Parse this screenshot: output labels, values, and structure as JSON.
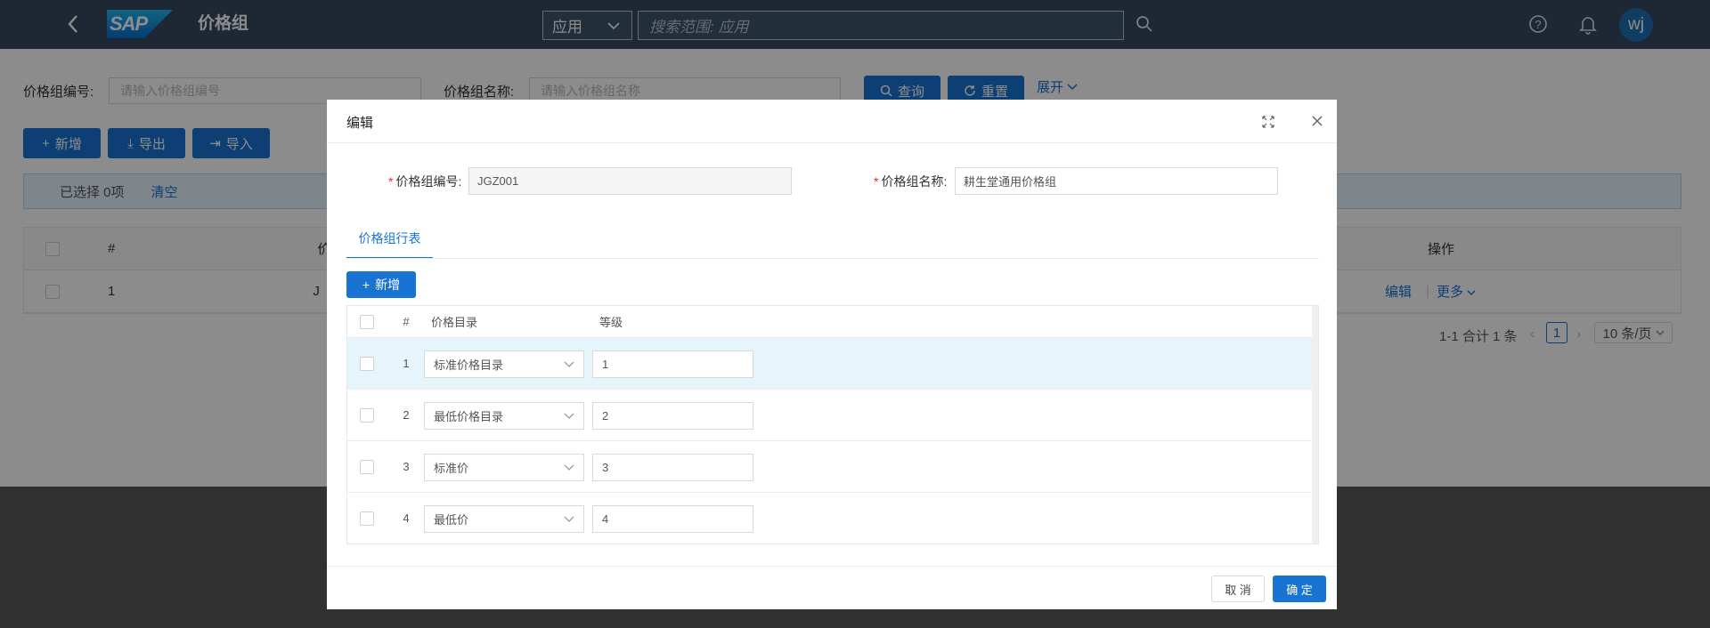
{
  "shell": {
    "app_title": "价格组",
    "logo_text": "SAP",
    "scope_value": "应用",
    "search_placeholder": "搜索范围: 应用",
    "avatar_initials": "wj"
  },
  "filters": {
    "code_label": "价格组编号:",
    "code_placeholder": "请输入价格组编号",
    "name_label": "价格组名称:",
    "name_placeholder": "请输入价格组名称",
    "query_label": "查询",
    "reset_label": "重置",
    "expand_label": "展开"
  },
  "toolbar": {
    "add_label": "新增",
    "export_label": "导出",
    "import_label": "导入"
  },
  "selection": {
    "summary": "已选择 0项",
    "clear_label": "清空"
  },
  "table": {
    "col_index": "#",
    "col_name_partial": "价",
    "col_actions": "操作",
    "row_index": "1",
    "row_partial": "J",
    "edit_label": "编辑",
    "more_label": "更多"
  },
  "pager": {
    "summary": "1-1 合计 1 条",
    "current_page": "1",
    "page_size": "10 条/页"
  },
  "modal": {
    "title": "编辑",
    "code_label": "价格组编号:",
    "code_value": "JGZ001",
    "name_label": "价格组名称:",
    "name_value": "耕生堂通用价格组",
    "tab_label": "价格组行表",
    "add_label": "新增",
    "col_index": "#",
    "col_catalog": "价格目录",
    "col_level": "等级",
    "rows": [
      {
        "index": "1",
        "catalog": "标准价格目录",
        "level": "1"
      },
      {
        "index": "2",
        "catalog": "最低价格目录",
        "level": "2"
      },
      {
        "index": "3",
        "catalog": "标准价",
        "level": "3"
      },
      {
        "index": "4",
        "catalog": "最低价",
        "level": "4"
      }
    ],
    "cancel_label": "取 消",
    "ok_label": "确 定"
  }
}
